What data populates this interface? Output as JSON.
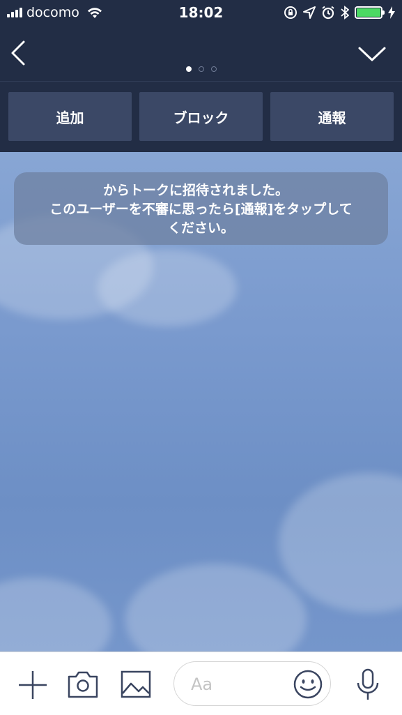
{
  "status_bar": {
    "carrier": "docomo",
    "time": "18:02"
  },
  "nav": {
    "page_dots": 3,
    "active_dot": 0
  },
  "actions": {
    "add_label": "追加",
    "block_label": "ブロック",
    "report_label": "通報"
  },
  "notice": {
    "line1": "からトークに招待されました。",
    "line2": "このユーザーを不審に思ったら[通報]をタップして",
    "line3": "ください。"
  },
  "input_bar": {
    "placeholder": "Aa",
    "icons": [
      "plus-icon",
      "camera-icon",
      "image-icon",
      "emoji-icon",
      "microphone-icon"
    ]
  },
  "colors": {
    "header_bg": "#222d45",
    "button_bg": "#3b4866",
    "battery_green": "#4cd964"
  }
}
